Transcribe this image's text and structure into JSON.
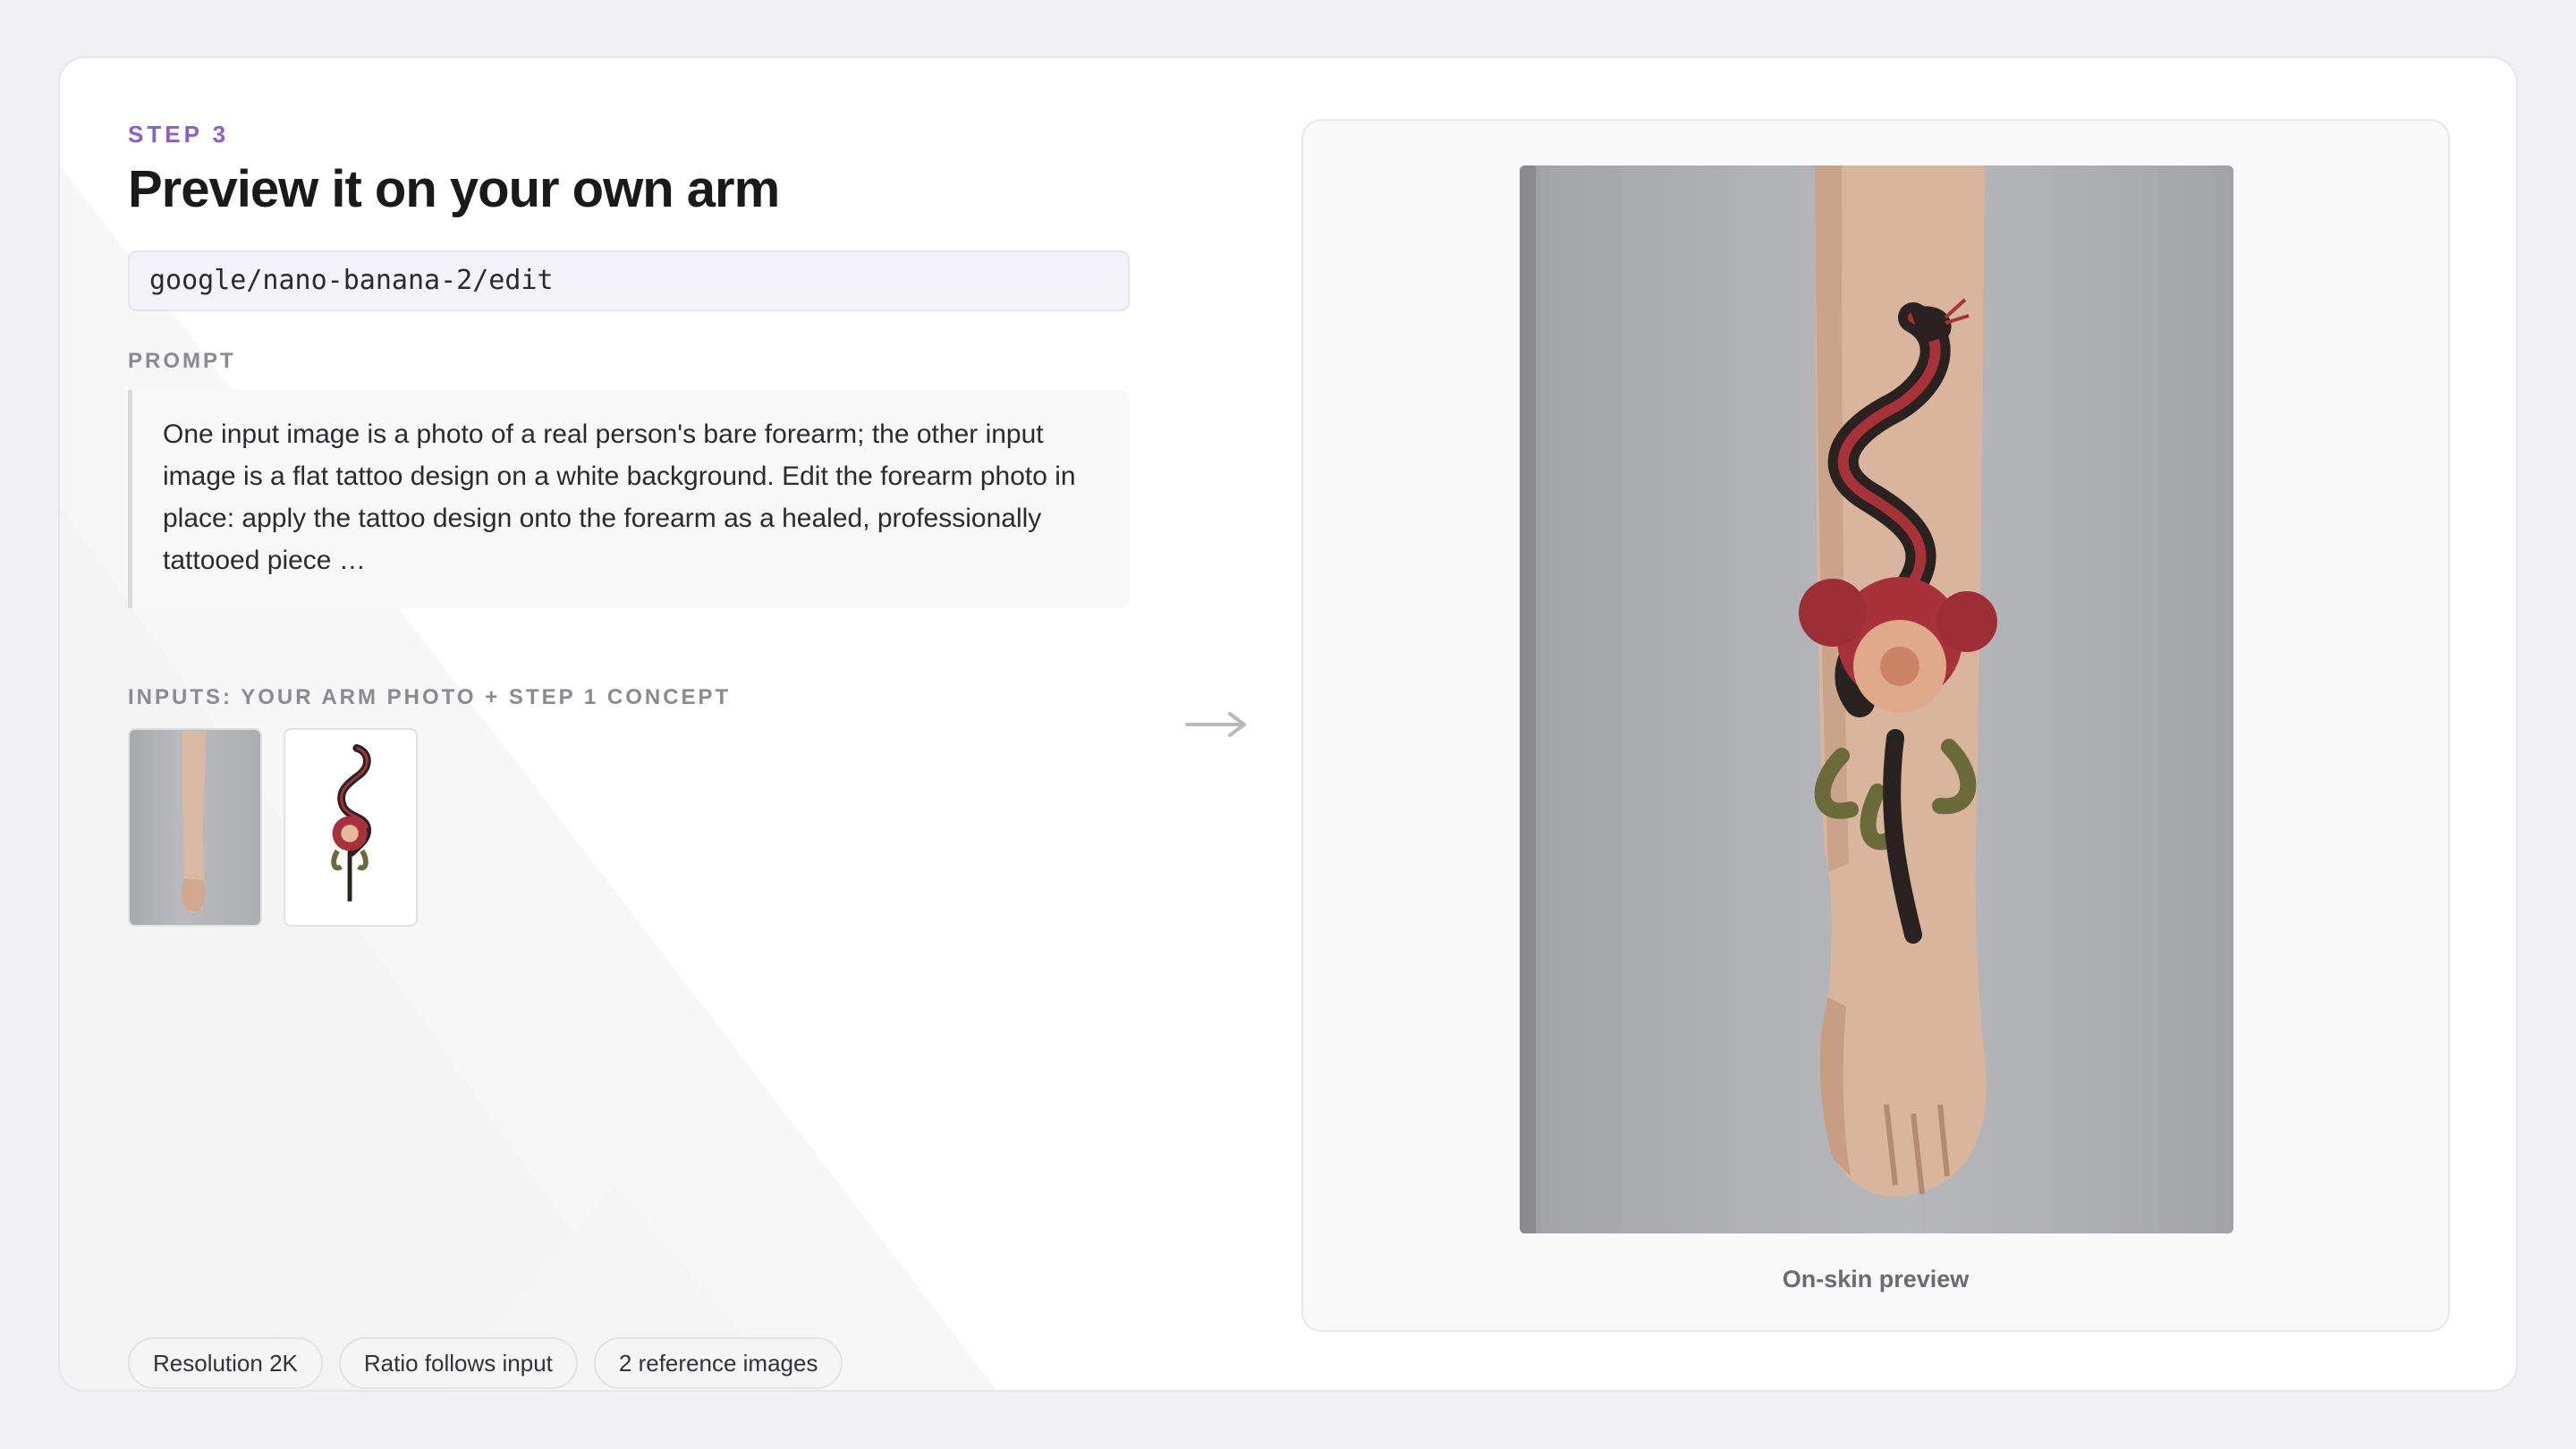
{
  "header": {
    "step": "STEP 3",
    "title": "Preview it on your own arm"
  },
  "model": {
    "id": "google/nano-banana-2/edit"
  },
  "prompt": {
    "label": "PROMPT",
    "text": "One input image is a photo of a real person's bare forearm; the other input image is a flat tattoo design on a white background. Edit the forearm photo in place: apply the tattoo design onto the forearm as a healed, professionally tattooed piece …"
  },
  "inputs": {
    "label": "INPUTS: YOUR ARM PHOTO + STEP 1 CONCEPT",
    "items": [
      {
        "kind": "arm-photo"
      },
      {
        "kind": "tattoo-concept"
      }
    ]
  },
  "chips": [
    "Resolution 2K",
    "Ratio follows input",
    "2 reference images"
  ],
  "preview": {
    "caption": "On-skin preview"
  },
  "colors": {
    "accent": "#8b5cd6",
    "tattoo_red": "#a8323a",
    "tattoo_black": "#2a2220"
  },
  "icons": [
    "arrow-right-icon"
  ]
}
